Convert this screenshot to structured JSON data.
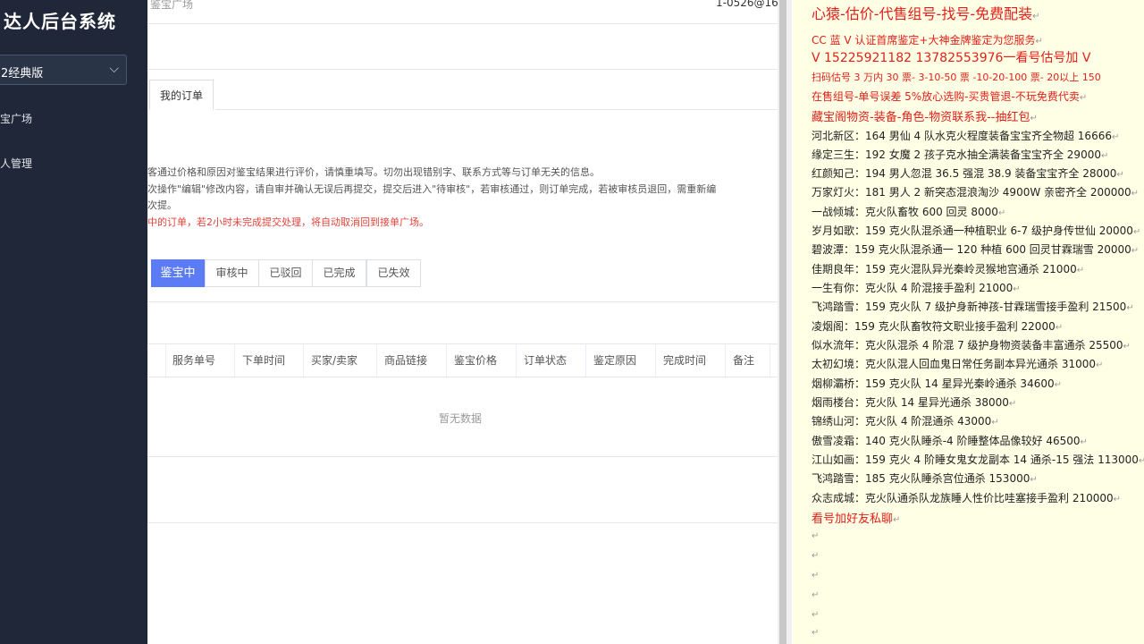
{
  "sidebar": {
    "title": "达人后台系统",
    "version": "2经典版",
    "items": [
      "宝广场",
      "人管理"
    ]
  },
  "header": {
    "breadcrumb": "鉴宝广场",
    "user": "1-0526@16"
  },
  "tabs": {
    "mine": "我的订单"
  },
  "notices": [
    "客通过价格和原因对鉴宝结果进行评价，请慎重填写。切勿出现错别字、联系方式等与订单无关的信息。",
    "次操作\"编辑\"修改内容，请自审并确认无误后再提交，提交后进入\"待审核\"，若审核通过，则订单完成，若被审核员退回，需重新编",
    "次提。",
    "中的订单，若2小时未完成提交处理，将自动取消回到接单广场。"
  ],
  "status_tabs": [
    "鉴宝中",
    "审核中",
    "已驳回",
    "已完成",
    "已失效"
  ],
  "table": {
    "columns": [
      "服务单号",
      "下单时间",
      "买家/卖家",
      "商品链接",
      "鉴宝价格",
      "订单状态",
      "鉴定原因",
      "完成时间",
      "备注"
    ],
    "empty_text": "暂无数据"
  },
  "notes": {
    "paragraph_mark": "↵",
    "red_lines": [
      "心猿-估价-代售组号-找号-免费配装",
      "CC 蓝 V 认证首席鉴定+大神金牌鉴定为您服务",
      "V 15225921182      13782553976一看号估号加 V",
      "扫码估号 3 万内 30 票- 3-10-50 票  -10-20-100 票- 20以上 150",
      "在售组号-单号误差 5%放心选购-买贵管退-不玩免费代卖",
      "藏宝阁物资-装备-角色-物资联系我--抽红包"
    ],
    "listings": [
      "河北新区：164 男仙 4 队水克火程度装备宝宝齐全物超 16666",
      "缘定三生：192 女魔 2 孩子克水抽全满装备宝宝齐全 29000",
      "红颜知己：194 男人忽混 36.5 强混 38.9 装备宝宝齐全 28000",
      "万家灯火：181 男人 2 新突态混浪淘沙 4900W 亲密齐全 200000",
      "一战倾城：克火队畜牧 600 回灵 8000",
      "岁月如歌：159 克火队混杀通一种植职业 6-7 级护身传世仙 20000",
      "碧波潭：159 克火队混杀通一 120 种植 600 回灵甘霖瑞雪 20000",
      "佳期良年：159 克火混队异光秦岭灵猴地宫通杀 21000",
      "一生有你：克火队 4 阶混接手盈利 21000",
      "飞鸿踏雪：159 克火队 7 级护身新神孩-甘霖瑞雪接手盈利 21500",
      "凌烟阁：159 克火队畜牧符文职业接手盈利 22000",
      "似水流年：克火队混杀 4 阶混 7 级护身物资装备丰富通杀 25500",
      "太初幻境：克火队混人回血鬼日常任务副本异光通杀 31000",
      "烟柳灞桥：159 克火队 14 星异光秦岭通杀 34600",
      "烟雨楼台：克火队 14 星异光通杀 38000",
      "锦绣山河：克火队 4 阶混通杀 43000",
      "傲雪凌霜：140 克火队睡杀-4 阶睡整体品像较好 46500",
      "江山如画：159 克火 4 阶睡女鬼女龙副本 14 通杀-15 强法 113000",
      "飞鸿踏雪：185 克火队睡杀宫位通杀 153000",
      "众志成城：克火队通杀队龙族睡人性价比哇塞接手盈利 210000"
    ],
    "footer_red": "看号加好友私聊"
  }
}
